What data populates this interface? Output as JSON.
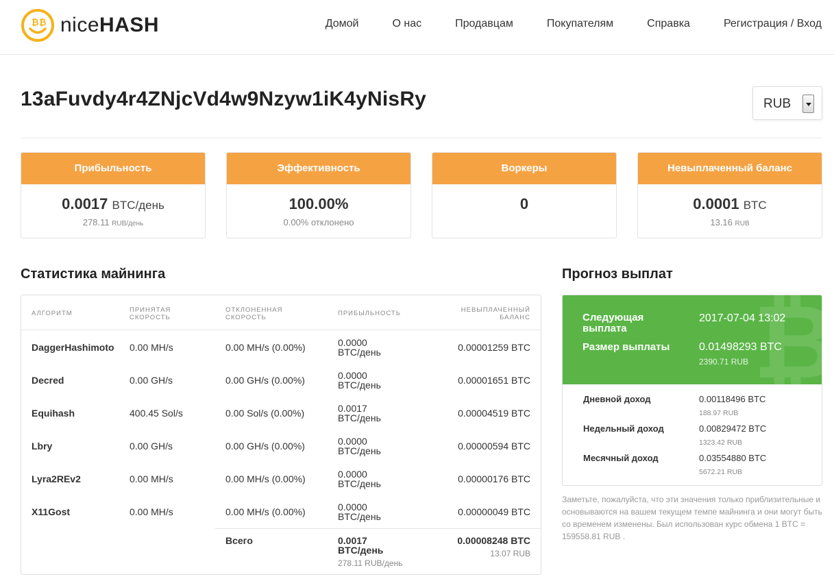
{
  "brand": {
    "name_thin": "nice",
    "name_bold": "HASH"
  },
  "nav": [
    "Домой",
    "О нас",
    "Продавцам",
    "Покупателям",
    "Справка",
    "Регистрация / Вход"
  ],
  "address": "13aFuvdy4r4ZNjcVd4w9Nzyw1iK4yNisRy",
  "currency_select": {
    "value": "RUB"
  },
  "cards": [
    {
      "title": "Прибыльность",
      "value": "0.0017",
      "unit": "BTC/день",
      "sub_value": "278.11",
      "sub_unit": "RUB/день"
    },
    {
      "title": "Эффективность",
      "value": "100.00%",
      "unit": "",
      "sub_value": "0.00% отклонено",
      "sub_unit": ""
    },
    {
      "title": "Воркеры",
      "value": "0",
      "unit": "",
      "sub_value": "",
      "sub_unit": ""
    },
    {
      "title": "Невыплаченный баланс",
      "value": "0.0001",
      "unit": "BTC",
      "sub_value": "13.16",
      "sub_unit": "RUB"
    }
  ],
  "mining": {
    "title": "Статистика майнинга",
    "headers": {
      "algo": "АЛГОРИТМ",
      "accepted_1": "ПРИНЯТАЯ",
      "accepted_2": "СКОРОСТЬ",
      "rejected_1": "ОТКЛОНЕННАЯ",
      "rejected_2": "СКОРОСТЬ",
      "profit": "ПРИБЫЛЬНОСТЬ",
      "unpaid_1": "НЕВЫПЛАЧЕННЫЙ",
      "unpaid_2": "БАЛАНС"
    },
    "rows": [
      {
        "algo": "DaggerHashimoto",
        "accepted": "0.00 MH/s",
        "rejected": "0.00 MH/s (0.00%)",
        "profit_1": "0.0000",
        "profit_2": "BTC/день",
        "unpaid": "0.00001259 BTC"
      },
      {
        "algo": "Decred",
        "accepted": "0.00 GH/s",
        "rejected": "0.00 GH/s (0.00%)",
        "profit_1": "0.0000",
        "profit_2": "BTC/день",
        "unpaid": "0.00001651 BTC"
      },
      {
        "algo": "Equihash",
        "accepted": "400.45 Sol/s",
        "rejected": "0.00 Sol/s (0.00%)",
        "profit_1": "0.0017",
        "profit_2": "BTC/день",
        "unpaid": "0.00004519 BTC"
      },
      {
        "algo": "Lbry",
        "accepted": "0.00 GH/s",
        "rejected": "0.00 GH/s (0.00%)",
        "profit_1": "0.0000",
        "profit_2": "BTC/день",
        "unpaid": "0.00000594 BTC"
      },
      {
        "algo": "Lyra2REv2",
        "accepted": "0.00 MH/s",
        "rejected": "0.00 MH/s (0.00%)",
        "profit_1": "0.0000",
        "profit_2": "BTC/день",
        "unpaid": "0.00000176 BTC"
      },
      {
        "algo": "X11Gost",
        "accepted": "0.00 MH/s",
        "rejected": "0.00 MH/s (0.00%)",
        "profit_1": "0.0000",
        "profit_2": "BTC/день",
        "unpaid": "0.00000049 BTC"
      }
    ],
    "total": {
      "label": "Всего",
      "profit_1": "0.0017",
      "profit_2": "BTC/день",
      "profit_fiat": "278.11 RUB/день",
      "unpaid": "0.00008248 BTC",
      "unpaid_fiat": "13.07 RUB"
    }
  },
  "payout": {
    "title": "Прогноз выплат",
    "next_label_1": "Следующая",
    "next_label_2": "выплата",
    "next_value": "2017-07-04 13:02",
    "size_label": "Размер выплаты",
    "size_value": "0.01498293 BTC",
    "size_fiat": "2390.71 RUB",
    "income": [
      {
        "label": "Дневной доход",
        "value": "0.00118496 BTC",
        "fiat": "188.97 RUB"
      },
      {
        "label": "Недельный доход",
        "value": "0.00829472 BTC",
        "fiat": "1323.42 RUB"
      },
      {
        "label": "Месячный доход",
        "value": "0.03554880 BTC",
        "fiat": "5672.21 RUB"
      }
    ],
    "note": "Заметьте, пожалуйста, что эти значения только приблизительные и основываются на вашем текущем темпе майнинга и они могут быть со временем изменены. Был использован курс обмена 1 BTC = 159558.81 RUB ."
  },
  "colors": {
    "orange": "#f5a243",
    "green": "#5ab546",
    "logo_yellow": "#f5b21b"
  },
  "icons": {
    "logo": "smiling-bitcoin-logo-icon",
    "watermark": "bitcoin-watermark-icon",
    "select_arrow": "chevron-down-icon"
  }
}
